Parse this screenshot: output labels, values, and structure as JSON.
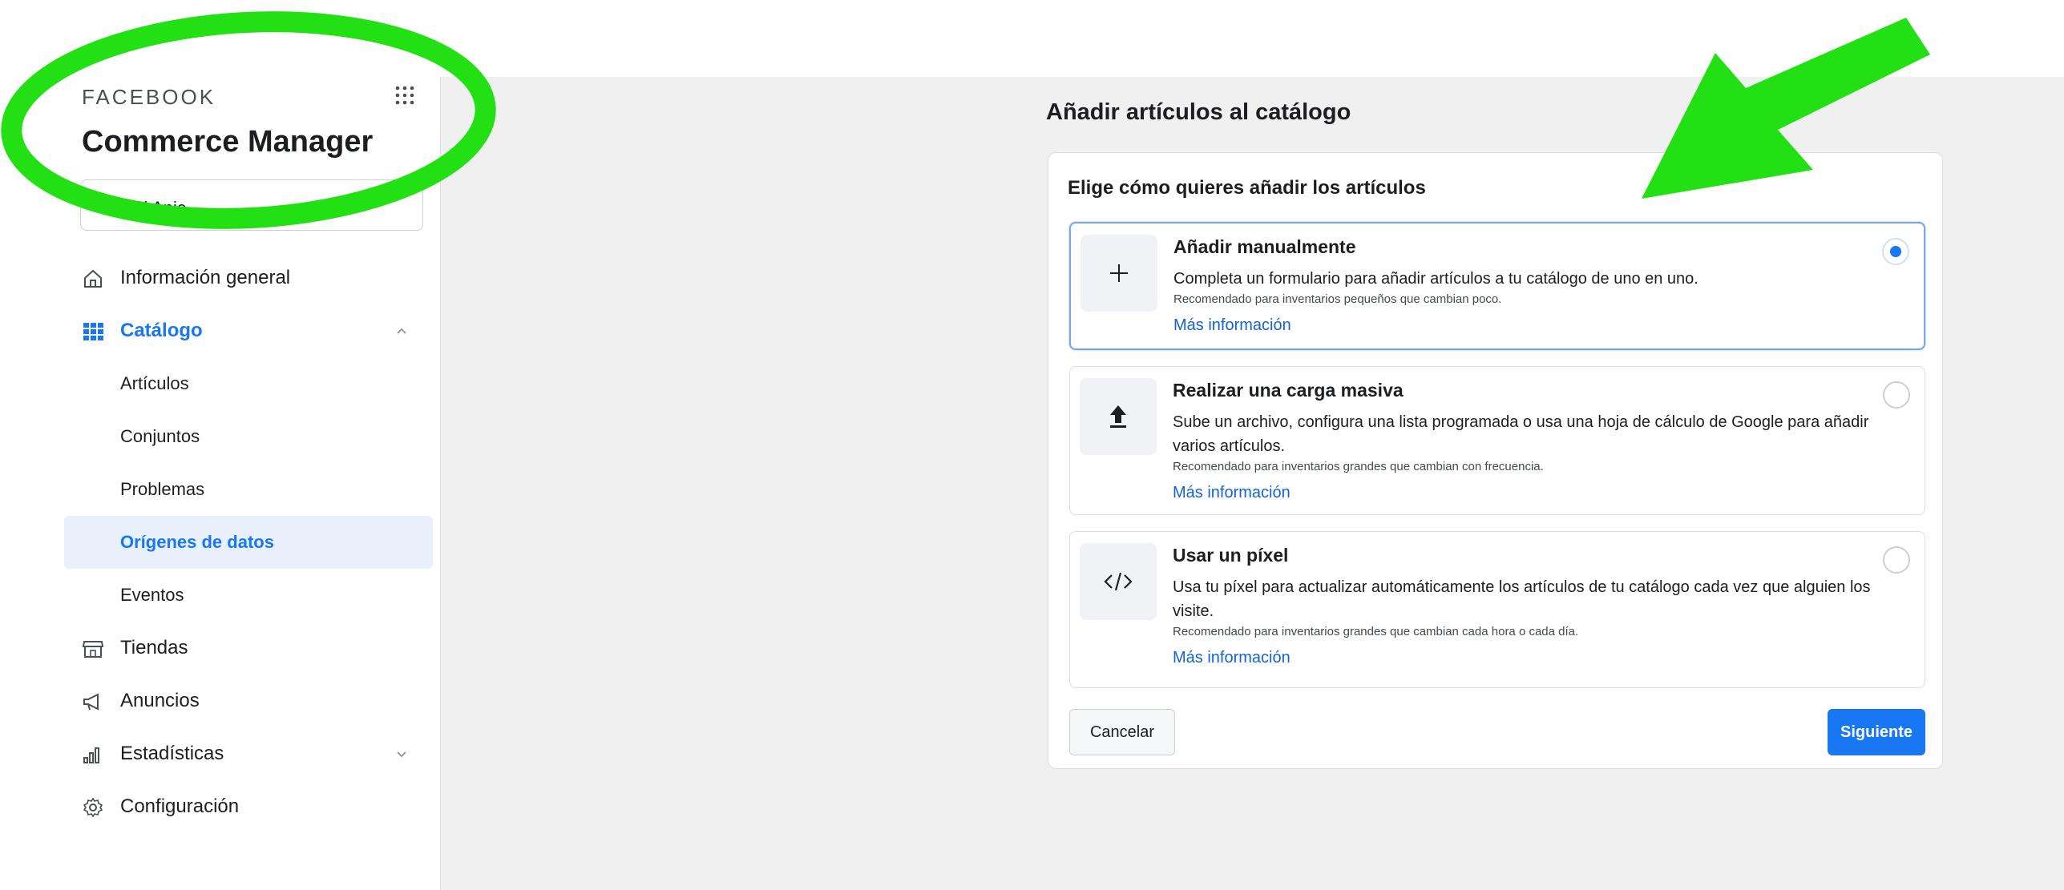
{
  "sidebar": {
    "brand": "FACEBOOK",
    "app_title": "Commerce Manager",
    "account_name": "Mi Anic",
    "nav": [
      {
        "label": "Información general",
        "icon": "home-icon"
      },
      {
        "label": "Catálogo",
        "icon": "catalog-grid-icon",
        "expanded": true
      },
      {
        "label": "Tiendas",
        "icon": "store-icon"
      },
      {
        "label": "Anuncios",
        "icon": "megaphone-icon"
      },
      {
        "label": "Estadísticas",
        "icon": "bar-chart-icon",
        "expanded": false
      },
      {
        "label": "Configuración",
        "icon": "gear-icon"
      }
    ],
    "catalog_sub": [
      {
        "label": "Artículos"
      },
      {
        "label": "Conjuntos"
      },
      {
        "label": "Problemas"
      },
      {
        "label": "Orígenes de datos",
        "selected": true
      },
      {
        "label": "Eventos"
      }
    ]
  },
  "main": {
    "page_title": "Añadir artículos al catálogo",
    "card_heading": "Elige cómo quieres añadir los artículos",
    "options": [
      {
        "icon": "plus-icon",
        "title": "Añadir manualmente",
        "desc": "Completa un formulario para añadir artículos a tu catálogo de uno en uno.",
        "rec": "Recomendado para inventarios pequeños que cambian poco.",
        "link": "Más información",
        "selected": true
      },
      {
        "icon": "upload-icon",
        "title": "Realizar una carga masiva",
        "desc": "Sube un archivo, configura una lista programada o usa una hoja de cálculo de Google para añadir varios artículos.",
        "rec": "Recomendado para inventarios grandes que cambian con frecuencia.",
        "link": "Más información",
        "selected": false
      },
      {
        "icon": "code-icon",
        "title": "Usar un píxel",
        "desc": "Usa tu píxel para actualizar automáticamente los artículos de tu catálogo cada vez que alguien los visite.",
        "rec": "Recomendado para inventarios grandes que cambian cada hora o cada día.",
        "link": "Más información",
        "selected": false
      }
    ],
    "cancel_label": "Cancelar",
    "next_label": "Siguiente"
  },
  "colors": {
    "accent": "#1877f2",
    "annotation_green": "#22e014",
    "main_bg": "#f0f0f1"
  }
}
